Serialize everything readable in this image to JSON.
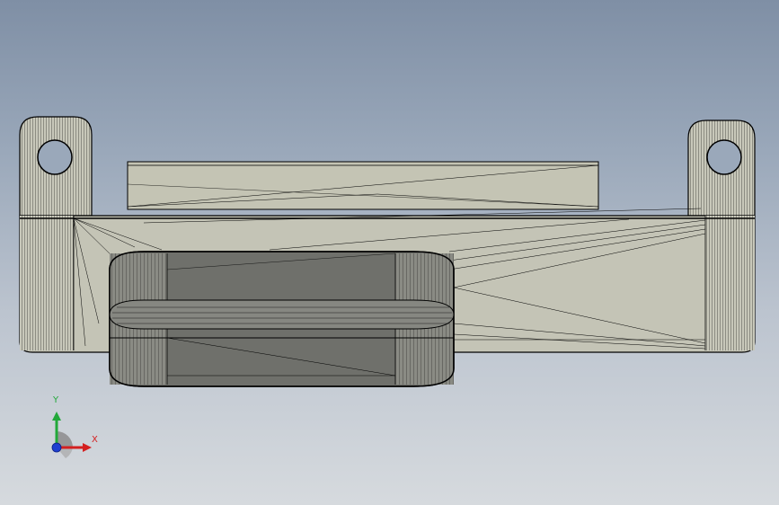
{
  "viewport": {
    "background_top": "#7f8fa5",
    "background_bottom": "#d6dade"
  },
  "model": {
    "face_color": "#c4c4b6",
    "edge_color": "#000000",
    "boss_color": "#6f706b"
  },
  "triad": {
    "x_label": "X",
    "y_label": "Y",
    "x_color": "#d42020",
    "y_color": "#22a83a",
    "z_color": "#1f3fd0"
  }
}
